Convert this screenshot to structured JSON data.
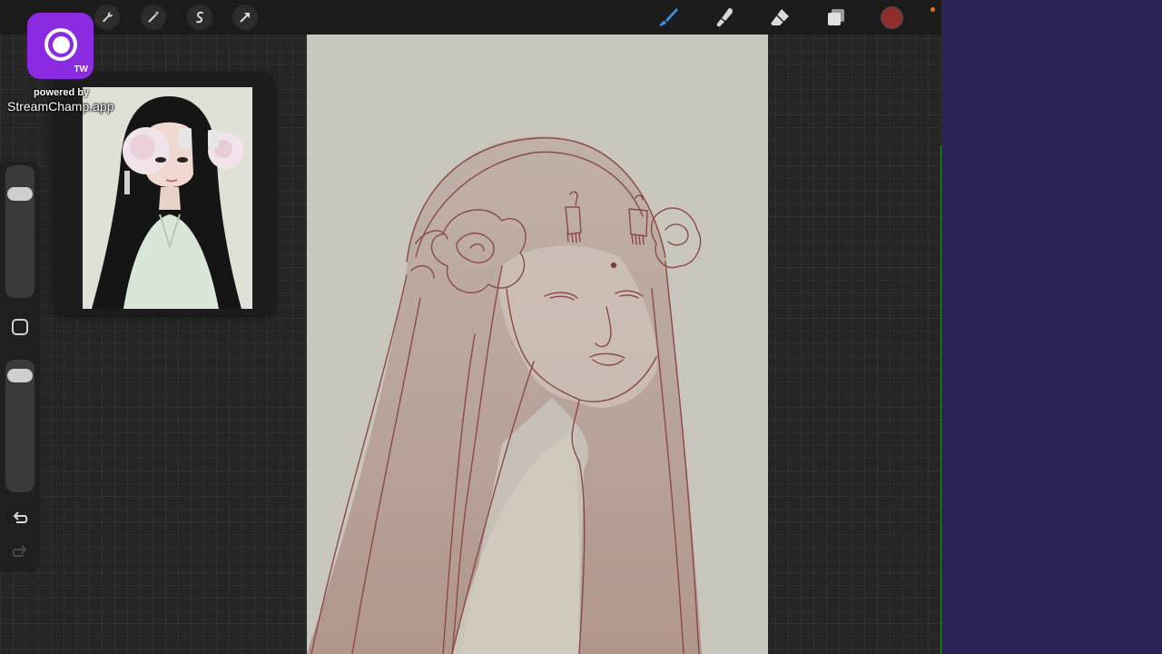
{
  "app": {
    "toolbar_left": [
      "gallery-icon",
      "wrench-icon",
      "magic-wand-icon",
      "selection-icon",
      "transform-arrow-icon"
    ],
    "toolbar_right": [
      "brush-icon",
      "smudge-icon",
      "eraser-icon",
      "layers-icon",
      "color-swatch"
    ],
    "current_color": "#8f2d2d",
    "accent_brush": "#3b8fe0",
    "canvas_color": "#c9c6bd",
    "sketch_color": "#8a4a46"
  },
  "sidebar": {
    "brush_size_slider": "brush-size",
    "opacity_slider": "opacity",
    "modifier_button": "square-icon",
    "undo": "undo-icon",
    "redo": "redo-icon"
  },
  "overlay": {
    "badge_text": "TW",
    "powered_by": "powered by",
    "brand": "StreamChamp.app",
    "badge_color": "#8a2be2"
  },
  "side_panel": {
    "color": "#2e2356"
  }
}
